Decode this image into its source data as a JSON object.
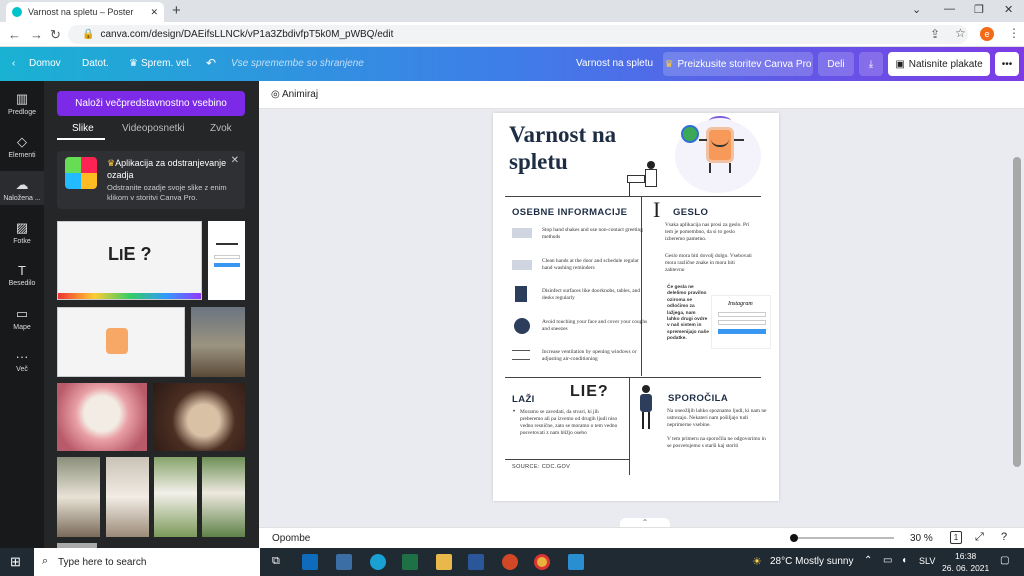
{
  "browser": {
    "tab_title": "Varnost na spletu – Poster",
    "url": "canva.com/design/DAEifsLLNCk/vP1a3ZbdivfpT5k0M_pWBQ/edit",
    "profile_initial": "e"
  },
  "header": {
    "home": "Domov",
    "file": "Datot.",
    "resize": "Sprem. vel.",
    "saved": "Vse spremembe so shranjene",
    "doc_title": "Varnost na spletu",
    "try_pro": "Preizkusite storitev Canva Pro",
    "share": "Deli",
    "print": "Natisnite plakate",
    "brand_color": "#7d2ae8"
  },
  "rail": [
    {
      "icon": "template-icon",
      "label": "Predloge"
    },
    {
      "icon": "elements-icon",
      "label": "Elementi"
    },
    {
      "icon": "upload-icon",
      "label": "Naložena ..."
    },
    {
      "icon": "photo-icon",
      "label": "Fotke"
    },
    {
      "icon": "text-icon",
      "label": "Besedilo"
    },
    {
      "icon": "folder-icon",
      "label": "Mape"
    },
    {
      "icon": "more-icon",
      "label": "Več"
    }
  ],
  "panel": {
    "upload_button": "Naloži večpredstavnostno vsebino",
    "tabs": [
      "Slike",
      "Videoposnetki",
      "Zvok"
    ],
    "promo_title": "Aplikacija za odstranjevanje ozadja",
    "promo_desc": "Odstranite ozadje svoje slike z enim klikom v storitvi Canva Pro."
  },
  "canvas": {
    "animate": "Animiraj",
    "notes": "Opombe",
    "zoom": "30 %",
    "page": "1"
  },
  "poster": {
    "title_line1": "Varnost na",
    "title_line2": "spletu",
    "section1": "OSEBNE INFORMACIJE",
    "section2": "GESLO",
    "section3": "LAŽI",
    "section4": "SPOROČILA",
    "tips": [
      "Stop hand shakes and use non-contact greeting methods",
      "Clean hands at the door and schedule regular hand washing reminders",
      "Disinfect surfaces like doorknobs, tables, and desks regularly",
      "Avoid touching your face and cover your coughs and sneezes",
      "Increase ventilation by opening windows or adjusting air-conditioning"
    ],
    "geslo1": "Vsaka aplikacija nas prosi za geslo. Pri tem je pomembno, da si to geslo izberemo pametno.",
    "geslo2": "Geslo mora biti dovolj dolgo. Vsebovati mora različne znake in mora biti zahtevno",
    "geslo3": "Če gesla ne delelimo pravilno oziroma se odločimo za lažjega, nam lahko drugi ovdre v naš sistem in spremenijajo naše podatke.",
    "instagram": "Instagram",
    "lie": "LIE?",
    "lazi_text": "Moramo se zavedati, da stvari, ki jih preberemo ali pa izvemo od drugih ljudi niso vedno resnične, zato se moramo o tem vedno posvetovati z nam bližjo osebo",
    "source": "SOURCE: CDC.GOV",
    "sporocila1": "Na oneožljih lahko spoznamo ljudi, ki nam ne ustrezajo. Nekateri nam pošiljajo tudi neprimerne vsebine.",
    "sporocila2": "V tem primeru na sporočila ne odgovorimo in se posvetujemo s starši kaj storiti"
  },
  "taskbar": {
    "search": "Type here to search",
    "weather": "28°C  Mostly sunny",
    "lang": "SLV",
    "time": "16:38",
    "date": "26. 06. 2021"
  }
}
